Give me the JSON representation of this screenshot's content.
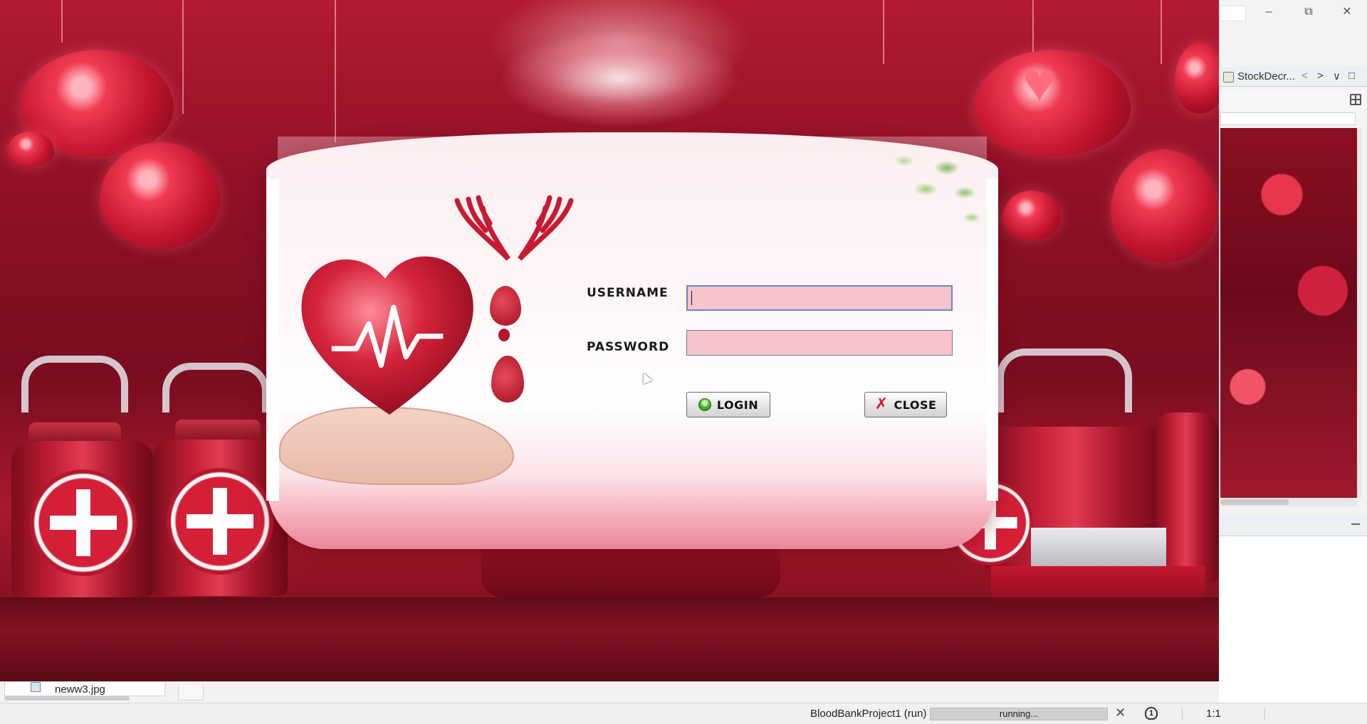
{
  "window_controls": {
    "minimize": "–",
    "restore": "⧉",
    "close": "✕"
  },
  "ide_panel": {
    "tab_label": "StockDecr...",
    "tab_file_icon": "java-file-icon",
    "nav_prev": "<",
    "nav_next": ">",
    "nav_dropdown": "∨",
    "maximize": "□"
  },
  "login": {
    "username_label": "USERNAME",
    "password_label": "PASSWORD",
    "username_value": "",
    "password_value": "",
    "login_label": "LOGIN",
    "close_label": "CLOSE",
    "close_icon": "✗"
  },
  "files": {
    "tab_label": "neww3.jpg"
  },
  "status": {
    "project": "BloodBankProject1 (run)",
    "progress_label": "running...",
    "cancel": "✕",
    "notifications": "1",
    "zoom": "1:1"
  },
  "colors": {
    "background_red": "#8e1026",
    "input_pink": "#f7c3cc",
    "login_icon_green": "#4dbb2d",
    "close_icon_red": "#e0141e"
  }
}
